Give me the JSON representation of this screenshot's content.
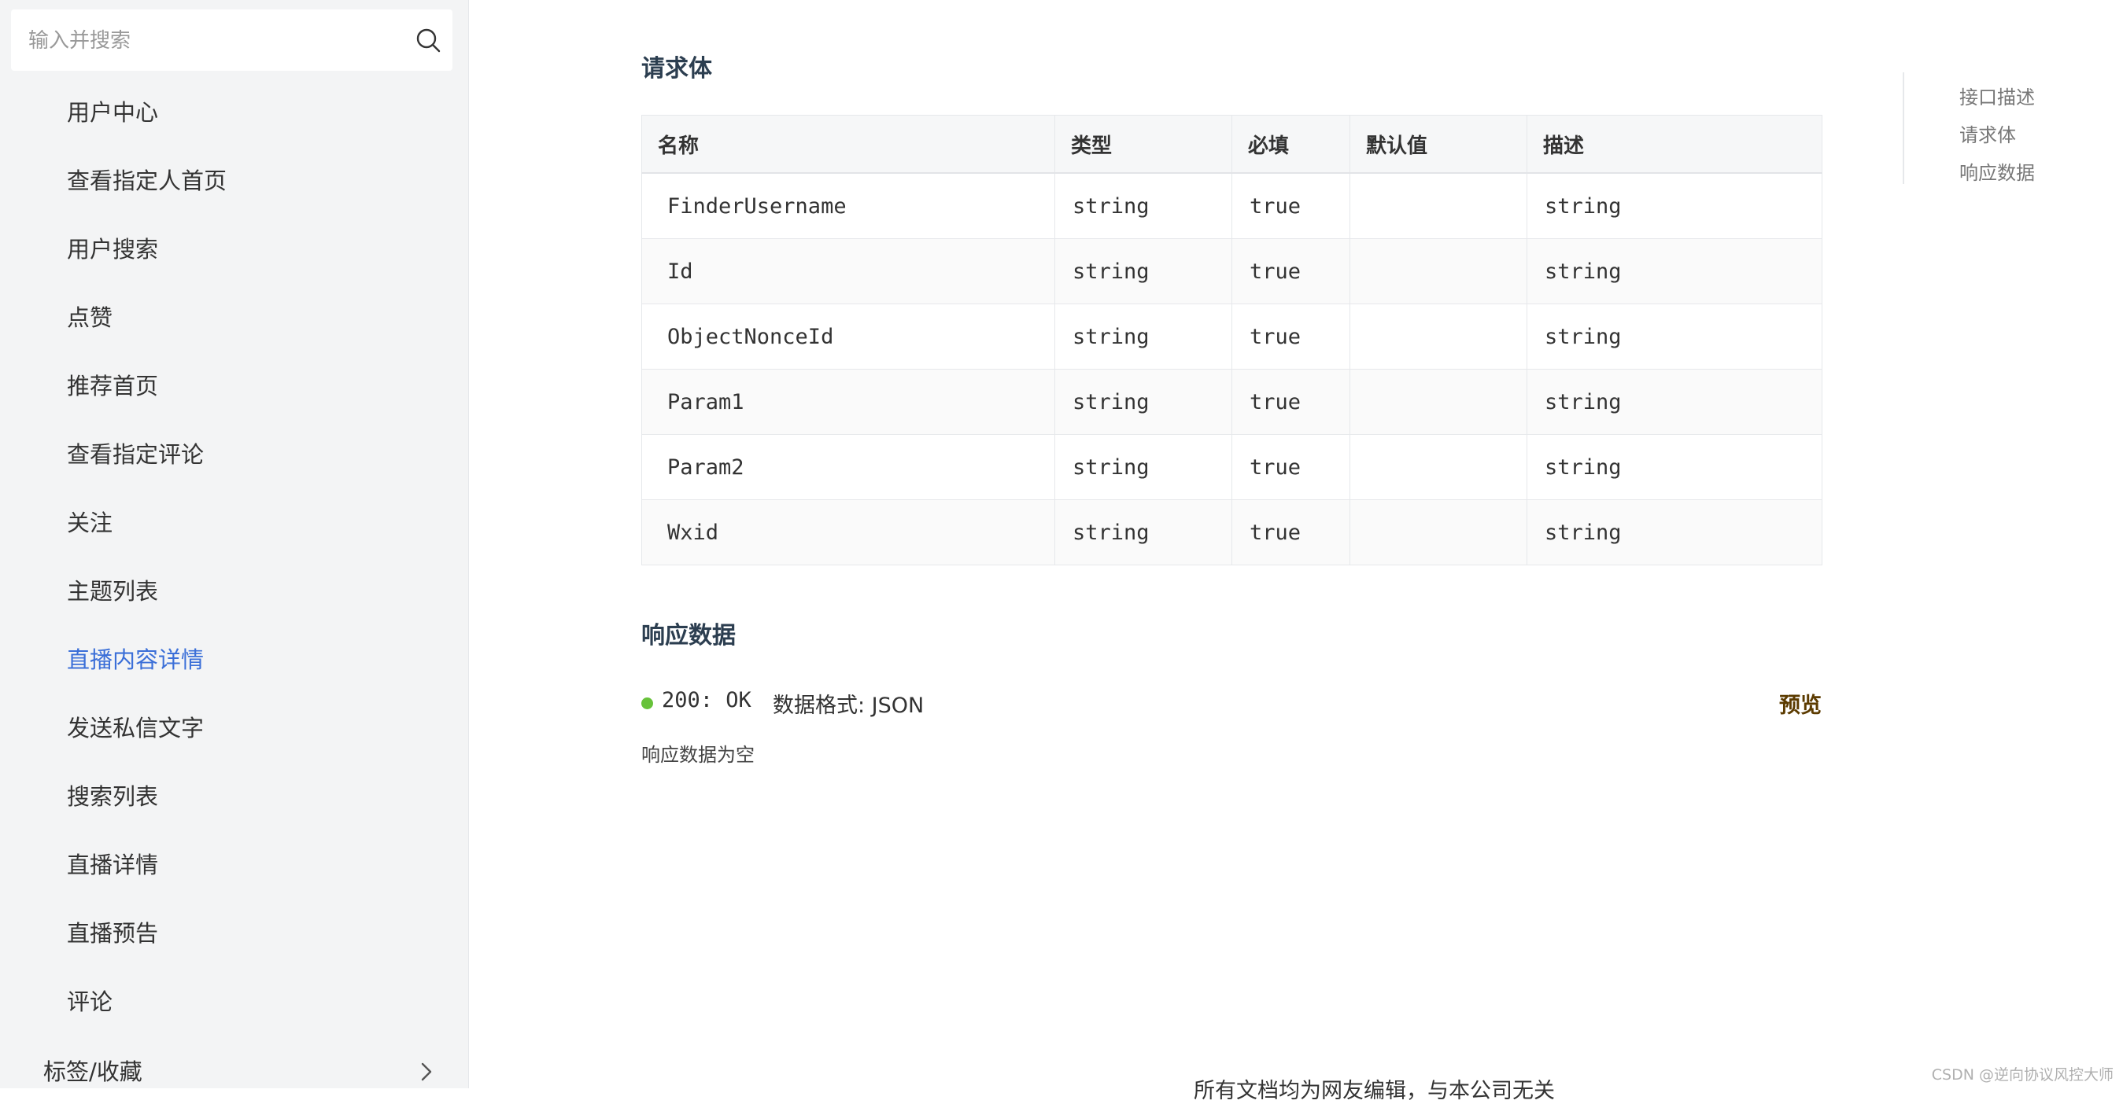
{
  "sidebar": {
    "search": {
      "placeholder": "输入并搜索"
    },
    "items": [
      {
        "label": "用户中心"
      },
      {
        "label": "查看指定人首页"
      },
      {
        "label": "用户搜索"
      },
      {
        "label": "点赞"
      },
      {
        "label": "推荐首页"
      },
      {
        "label": "查看指定评论"
      },
      {
        "label": "关注"
      },
      {
        "label": "主题列表"
      },
      {
        "label": "直播内容详情",
        "active": true
      },
      {
        "label": "发送私信文字"
      },
      {
        "label": "搜索列表"
      },
      {
        "label": "直播详情"
      },
      {
        "label": "直播预告"
      },
      {
        "label": "评论"
      }
    ],
    "group": {
      "label": "标签/收藏"
    }
  },
  "request": {
    "title": "请求体",
    "columns": [
      "名称",
      "类型",
      "必填",
      "默认值",
      "描述"
    ],
    "rows": [
      [
        "FinderUsername",
        "string",
        "true",
        "",
        "string"
      ],
      [
        "Id",
        "string",
        "true",
        "",
        "string"
      ],
      [
        "ObjectNonceId",
        "string",
        "true",
        "",
        "string"
      ],
      [
        "Param1",
        "string",
        "true",
        "",
        "string"
      ],
      [
        "Param2",
        "string",
        "true",
        "",
        "string"
      ],
      [
        "Wxid",
        "string",
        "true",
        "",
        "string"
      ]
    ]
  },
  "response": {
    "title": "响应数据",
    "status_code": "200: OK",
    "format": "数据格式: JSON",
    "preview_label": "预览",
    "empty_note": "响应数据为空",
    "status_color": "#67c23a"
  },
  "toc": {
    "items": [
      {
        "label": "接口描述"
      },
      {
        "label": "请求体"
      },
      {
        "label": "响应数据"
      }
    ]
  },
  "footer": {
    "text": "所有文档均为网友编辑，与本公司无关"
  },
  "watermark": {
    "text": "CSDN @逆向协议风控大师"
  },
  "colors": {
    "accent": "#3b6fd8",
    "preview": "#5c3b00"
  }
}
